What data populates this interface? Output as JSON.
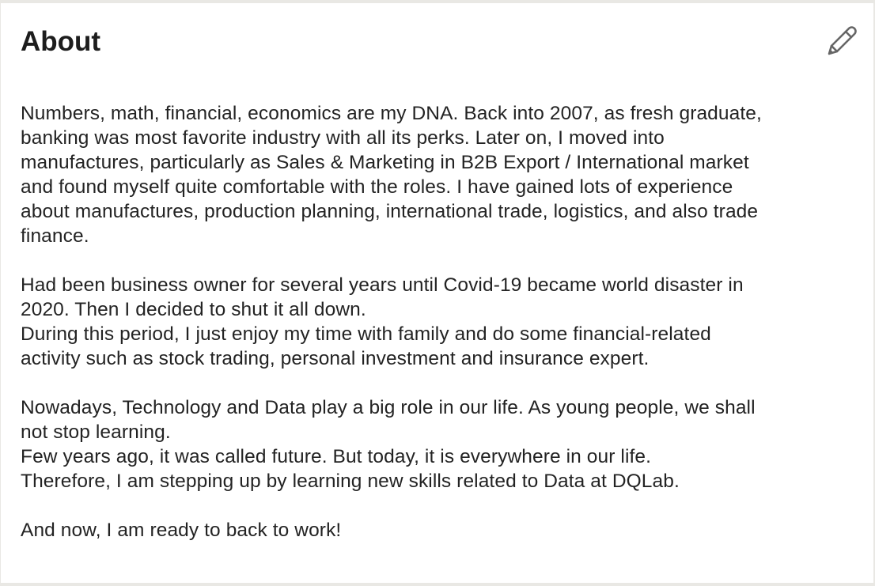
{
  "section": {
    "title": "About",
    "edit_icon": "pencil-icon"
  },
  "about": {
    "paragraphs": [
      {
        "lines": [
          "Numbers, math, financial, economics are my DNA. Back into 2007, as fresh graduate,",
          "banking was most favorite industry with all its perks. Later on, I moved into",
          "manufactures, particularly as Sales & Marketing in B2B Export / International market",
          "and found myself quite comfortable with the roles. I have gained lots of experience",
          "about manufactures, production planning, international trade, logistics, and also trade",
          "finance."
        ]
      },
      {
        "lines": [
          "Had been business owner for several years until Covid-19 became world disaster in",
          "2020. Then I decided to shut it all down.",
          "During this period, I just enjoy my time with family and do some financial-related",
          "activity such as stock trading, personal investment and insurance expert."
        ]
      },
      {
        "lines": [
          "Nowadays, Technology and Data play a big role in our life. As young people, we shall",
          "not stop learning.",
          "Few years ago, it was called future. But today, it is everywhere in our life.",
          "Therefore, I am stepping up by learning new skills related to Data at DQLab."
        ]
      },
      {
        "lines": [
          "And now, I am ready to back to work!"
        ]
      }
    ]
  }
}
